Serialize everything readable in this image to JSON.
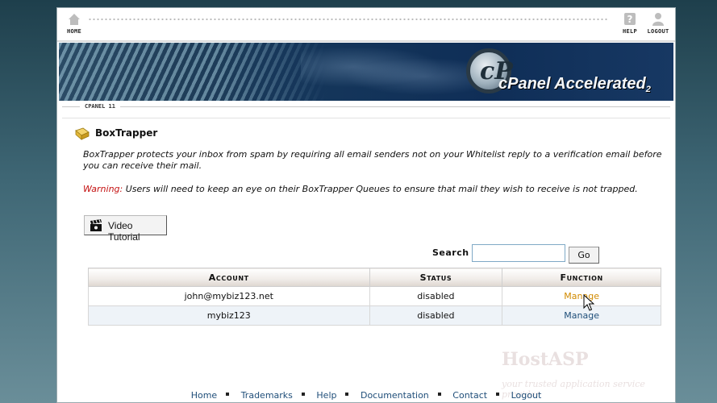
{
  "nav": {
    "home_label": "HOME",
    "help_label": "HELP",
    "logout_label": "LOGOUT"
  },
  "banner": {
    "brand_main": "cPanel Accelerated",
    "brand_sub": "2"
  },
  "breadcrumb": "CPANEL 11",
  "page": {
    "title": "BoxTrapper",
    "description": "BoxTrapper protects your inbox from spam by requiring all email senders not on your Whitelist reply to a verification email before you can receive their mail.",
    "warning_label": "Warning:",
    "warning_text": " Users will need to keep an eye on their BoxTrapper Queues to ensure that mail they wish to receive is not trapped."
  },
  "video_button": {
    "label": "Video Tutorial",
    "icon": "clapperboard-icon"
  },
  "search": {
    "label": "Search",
    "value": "",
    "go_label": "Go"
  },
  "table": {
    "headers": [
      "Account",
      "Status",
      "Function"
    ],
    "rows": [
      {
        "account": "john@mybiz123.net",
        "status": "disabled",
        "function": "Manage"
      },
      {
        "account": "mybiz123",
        "status": "disabled",
        "function": "Manage"
      }
    ]
  },
  "watermark": {
    "title": "HostASP",
    "tagline": "your trusted application service provider"
  },
  "footer": {
    "links": [
      "Home",
      "Trademarks",
      "Help",
      "Documentation",
      "Contact",
      "Logout"
    ]
  },
  "colors": {
    "link": "#1f4e79",
    "link_hover": "#d18a00",
    "warning": "#c41010",
    "table_header_bg": "#f0ece8"
  }
}
